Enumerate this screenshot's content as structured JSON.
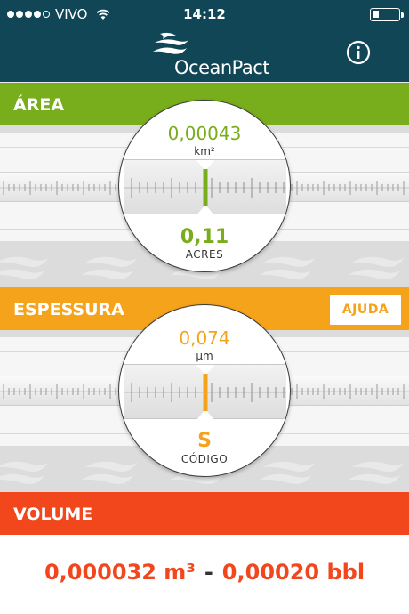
{
  "status_bar": {
    "carrier": "VIVO",
    "time": "14:12",
    "signal_dots_filled": 4,
    "signal_dots_total": 5,
    "battery_level": 0.2
  },
  "header": {
    "brand": "OceanPact",
    "info_icon": "info-icon"
  },
  "area": {
    "title": "ÁREA",
    "value_top": "0,00043",
    "unit_top": "km²",
    "value_bottom": "0,11",
    "unit_bottom": "ACRES"
  },
  "thickness": {
    "title": "ESPESSURA",
    "help_label": "AJUDA",
    "value_top": "0,074",
    "unit_top": "µm",
    "value_bottom": "S",
    "unit_bottom": "CÓDIGO"
  },
  "volume": {
    "title": "VOLUME",
    "value_m3": "0,000032 m³",
    "separator": "-",
    "value_bbl": "0,00020 bbl"
  },
  "colors": {
    "navbar": "#114656",
    "area": "#78ad1c",
    "thickness": "#f5a31b",
    "volume": "#f2461d"
  }
}
